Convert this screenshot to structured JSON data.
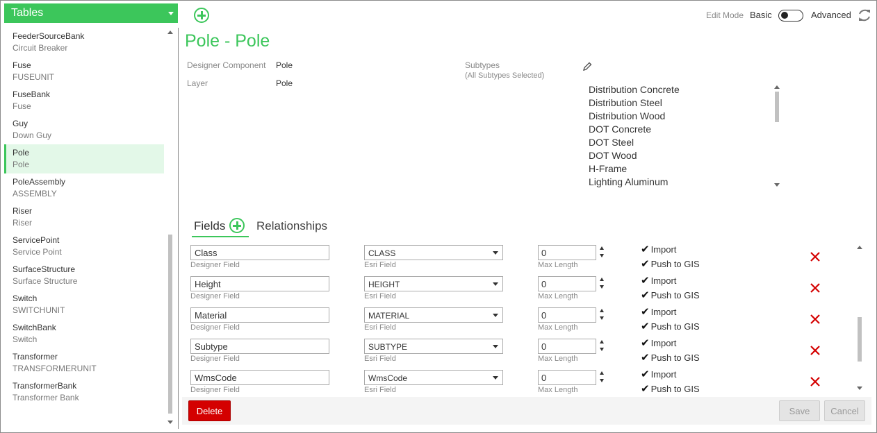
{
  "sidebar": {
    "header": "Tables",
    "items": [
      {
        "name": "FeederSourceBank",
        "sub": "Circuit Breaker"
      },
      {
        "name": "Fuse",
        "sub": "FUSEUNIT"
      },
      {
        "name": "FuseBank",
        "sub": "Fuse"
      },
      {
        "name": "Guy",
        "sub": "Down Guy"
      },
      {
        "name": "Pole",
        "sub": "Pole",
        "selected": true
      },
      {
        "name": "PoleAssembly",
        "sub": "ASSEMBLY"
      },
      {
        "name": "Riser",
        "sub": "Riser"
      },
      {
        "name": "ServicePoint",
        "sub": "Service Point"
      },
      {
        "name": "SurfaceStructure",
        "sub": "Surface Structure"
      },
      {
        "name": "Switch",
        "sub": "SWITCHUNIT"
      },
      {
        "name": "SwitchBank",
        "sub": "Switch"
      },
      {
        "name": "Transformer",
        "sub": "TRANSFORMERUNIT"
      },
      {
        "name": "TransformerBank",
        "sub": "Transformer Bank"
      }
    ]
  },
  "topbar": {
    "edit_mode_label": "Edit Mode",
    "basic_label": "Basic",
    "advanced_label": "Advanced"
  },
  "detail": {
    "title": "Pole - Pole",
    "designer_component_label": "Designer Component",
    "designer_component_value": "Pole",
    "layer_label": "Layer",
    "layer_value": "Pole",
    "subtypes_label": "Subtypes",
    "subtypes_note": "(All Subtypes Selected)",
    "subtypes": [
      "Distribution Concrete",
      "Distribution Steel",
      "Distribution Wood",
      "DOT Concrete",
      "DOT Steel",
      "DOT Wood",
      "H-Frame",
      "Lighting Aluminum"
    ]
  },
  "tabs": {
    "fields": "Fields",
    "relationships": "Relationships"
  },
  "field_hints": {
    "designer_field": "Designer Field",
    "esri_field": "Esri Field",
    "max_length": "Max Length",
    "import": "Import",
    "push_to_gis": "Push to GIS"
  },
  "fields": [
    {
      "designer": "Class",
      "esri": "CLASS",
      "max_length": "0"
    },
    {
      "designer": "Height",
      "esri": "HEIGHT",
      "max_length": "0"
    },
    {
      "designer": "Material",
      "esri": "MATERIAL",
      "max_length": "0"
    },
    {
      "designer": "Subtype",
      "esri": "SUBTYPE",
      "max_length": "0"
    },
    {
      "designer": "WmsCode",
      "esri": "WmsCode",
      "max_length": "0"
    }
  ],
  "buttons": {
    "delete": "Delete",
    "save": "Save",
    "cancel": "Cancel"
  },
  "colors": {
    "accent": "#3cc65b",
    "danger": "#d40000"
  }
}
